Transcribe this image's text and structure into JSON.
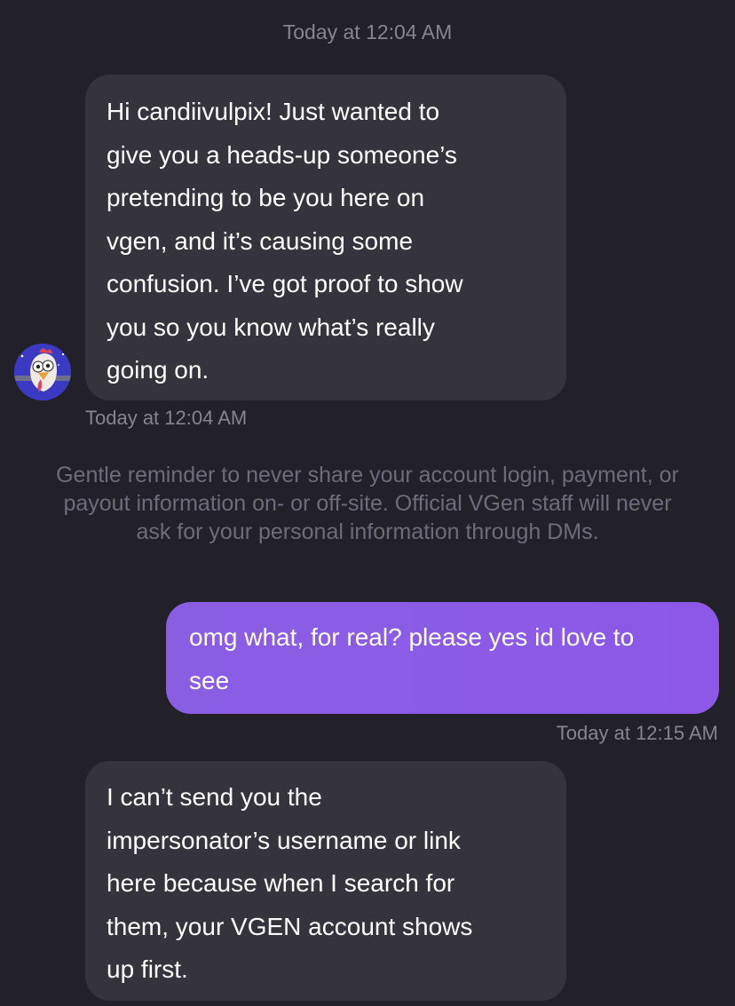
{
  "conversation": {
    "timestamp_top": "Today at 12:04 AM",
    "message1": {
      "text": "Hi candiivulpix! Just wanted to\ngive you a heads-up someone’s\npretending to be you here on\nvgen, and it’s causing some\nconfusion. I’ve got proof to show\nyou so you know what’s really\ngoing on.",
      "timestamp": "Today at 12:04 AM"
    },
    "notice": "Gentle reminder to never share your account login, payment, or payout information on- or off-site. Official VGen staff will never ask for your personal information through DMs.",
    "message2": {
      "text": "omg what, for real? please yes id love to\nsee",
      "timestamp": "Today at 12:15 AM"
    },
    "message3": {
      "text": "I can’t send you the\nimpersonator’s username or link\nhere because when I search for\nthem, your VGEN account shows\nup first."
    }
  },
  "colors": {
    "background": "#22212a",
    "incoming_bubble": "#35343d",
    "outgoing_bubble": "#8b5ce6",
    "timestamp": "#86848f",
    "notice": "#6e6c78"
  },
  "icons": {
    "avatar": "rooster-avatar"
  }
}
